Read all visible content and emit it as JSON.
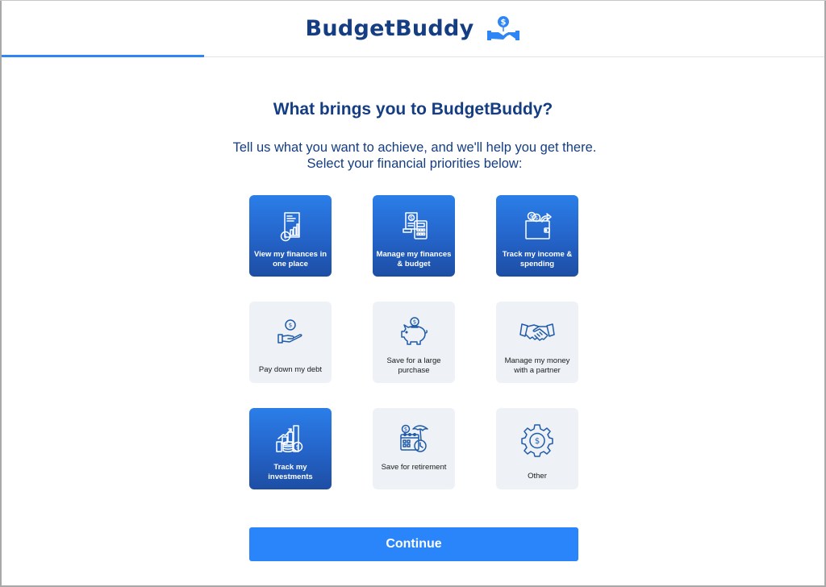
{
  "header": {
    "brand_name": "BudgetBuddy",
    "logo_icon": "hand-coin-handshake-icon"
  },
  "progress": {
    "percent": 24.5
  },
  "main": {
    "title": "What brings you to BudgetBuddy?",
    "subtitle": "Tell us what you want to achieve, and we'll help you get there. Select your financial priorities below:"
  },
  "options": [
    {
      "label": "View my finances in one place",
      "icon": "report-chart-icon",
      "selected": true
    },
    {
      "label": "Manage my finances & budget",
      "icon": "receipt-calculator-icon",
      "selected": true
    },
    {
      "label": "Track my income & spending",
      "icon": "wallet-coins-icon",
      "selected": true
    },
    {
      "label": "Pay down my debt",
      "icon": "hand-coin-icon",
      "selected": false
    },
    {
      "label": "Save for a large purchase",
      "icon": "piggy-bank-icon",
      "selected": false
    },
    {
      "label": "Manage my money with a partner",
      "icon": "handshake-icon",
      "selected": false
    },
    {
      "label": "Track my investments",
      "icon": "investment-growth-icon",
      "selected": true
    },
    {
      "label": "Save for retirement",
      "icon": "calendar-umbrella-clock-icon",
      "selected": false
    },
    {
      "label": "Other",
      "icon": "gear-dollar-icon",
      "selected": false
    }
  ],
  "colors": {
    "brand": "#143d82",
    "accent": "#2a85fb",
    "card_unselected_bg": "#eef2f7"
  },
  "actions": {
    "continue_label": "Continue"
  }
}
